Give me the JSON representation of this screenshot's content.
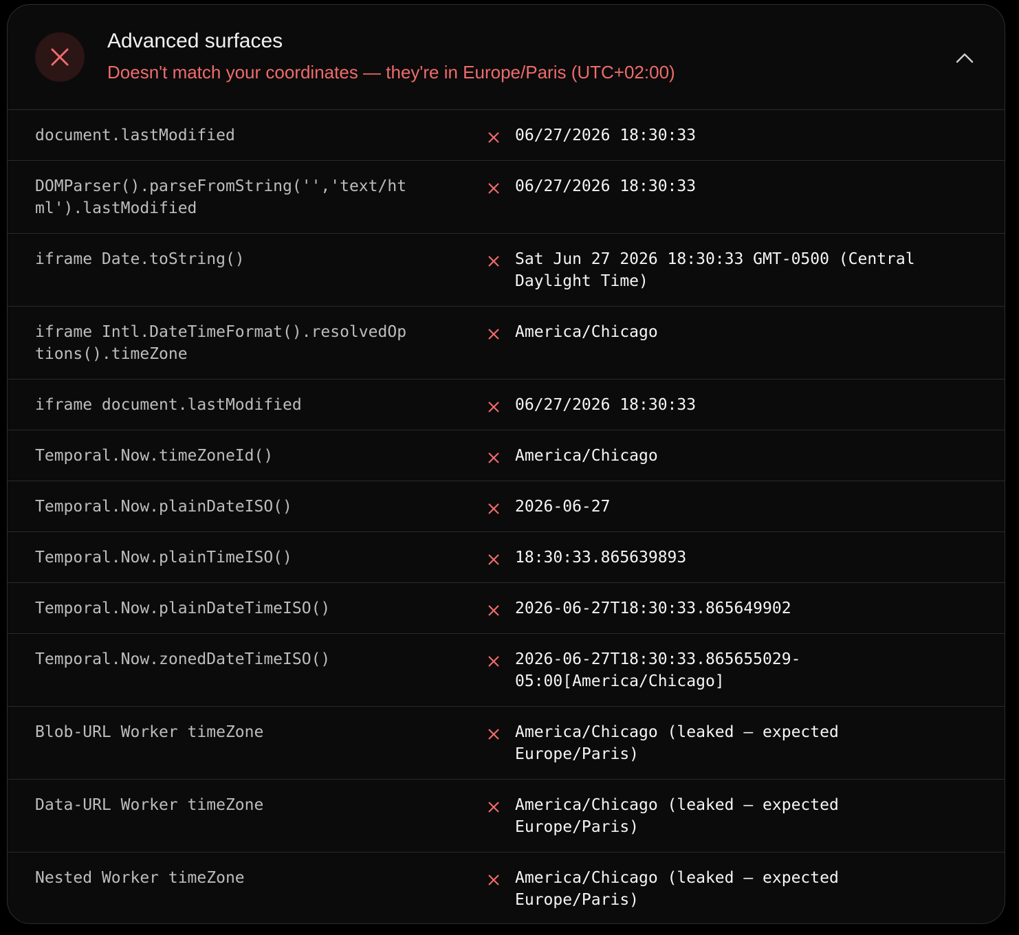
{
  "header": {
    "title": "Advanced surfaces",
    "subtitle": "Doesn't match your coordinates — they're in Europe/Paris (UTC+02:00)",
    "status_icon": "close-icon",
    "collapse_icon": "chevron-up-icon",
    "status_color": "#f06b6b"
  },
  "rows": [
    {
      "label": "document.lastModified",
      "value": "06/27/2026 18:30:33",
      "status": "fail"
    },
    {
      "label": "DOMParser().parseFromString('','text/ht\nml').lastModified",
      "value": "06/27/2026 18:30:33",
      "status": "fail"
    },
    {
      "label": "iframe Date.toString()",
      "value": "Sat Jun 27 2026 18:30:33 GMT-0500 (Central\nDaylight Time)",
      "status": "fail"
    },
    {
      "label": "iframe Intl.DateTimeFormat().resolvedOp\ntions().timeZone",
      "value": "America/Chicago",
      "status": "fail"
    },
    {
      "label": "iframe document.lastModified",
      "value": "06/27/2026 18:30:33",
      "status": "fail"
    },
    {
      "label": "Temporal.Now.timeZoneId()",
      "value": "America/Chicago",
      "status": "fail"
    },
    {
      "label": "Temporal.Now.plainDateISO()",
      "value": "2026-06-27",
      "status": "fail"
    },
    {
      "label": "Temporal.Now.plainTimeISO()",
      "value": "18:30:33.865639893",
      "status": "fail"
    },
    {
      "label": "Temporal.Now.plainDateTimeISO()",
      "value": "2026-06-27T18:30:33.865649902",
      "status": "fail"
    },
    {
      "label": "Temporal.Now.zonedDateTimeISO()",
      "value": "2026-06-27T18:30:33.865655029-\n05:00[America/Chicago]",
      "status": "fail"
    },
    {
      "label": "Blob-URL Worker timeZone",
      "value": "America/Chicago (leaked — expected\nEurope/Paris)",
      "status": "fail"
    },
    {
      "label": "Data-URL Worker timeZone",
      "value": "America/Chicago (leaked — expected\nEurope/Paris)",
      "status": "fail"
    },
    {
      "label": "Nested Worker timeZone",
      "value": "America/Chicago (leaked — expected\nEurope/Paris)",
      "status": "fail"
    }
  ]
}
